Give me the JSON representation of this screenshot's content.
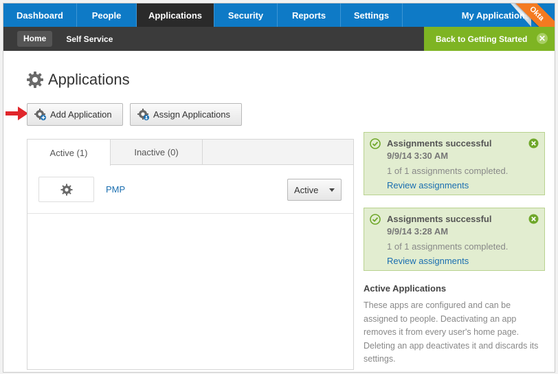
{
  "top_nav": {
    "tabs": [
      "Dashboard",
      "People",
      "Applications",
      "Security",
      "Reports",
      "Settings"
    ],
    "active_tab": "Applications",
    "my_applications": "My Applications",
    "ribbon": "Okta"
  },
  "sub_nav": {
    "home": "Home",
    "self_service": "Self Service",
    "back_link": "Back to Getting Started"
  },
  "page": {
    "title": "Applications"
  },
  "toolbar": {
    "add_label": "Add Application",
    "assign_label": "Assign Applications"
  },
  "tabs": {
    "active": "Active (1)",
    "inactive": "Inactive (0)"
  },
  "apps": [
    {
      "name": "PMP",
      "status": "Active"
    }
  ],
  "notifications": [
    {
      "title": "Assignments successful",
      "time": "9/9/14 3:30 AM",
      "desc": "1 of 1 assignments completed.",
      "link": "Review assignments"
    },
    {
      "title": "Assignments successful",
      "time": "9/9/14 3:28 AM",
      "desc": "1 of 1 assignments completed.",
      "link": "Review assignments"
    }
  ],
  "info": {
    "title": "Active Applications",
    "text": "These apps are configured and can be assigned to people. Deactivating an app removes it from every user's home page. Deleting an app deactivates it and discards its settings."
  },
  "colors": {
    "nav_blue": "#0e7ac6",
    "nav_active": "#2a2a2a",
    "subnav": "#3b3b3b",
    "green": "#7eb423",
    "link": "#1a6eb0",
    "okta_orange": "#f47a20",
    "arrow_red": "#e0262b"
  },
  "icons": [
    "gear-icon",
    "gear-plus-icon",
    "gear-person-icon",
    "check-circle-icon",
    "close-circle-icon",
    "red-arrow-icon",
    "caret-down-icon"
  ]
}
